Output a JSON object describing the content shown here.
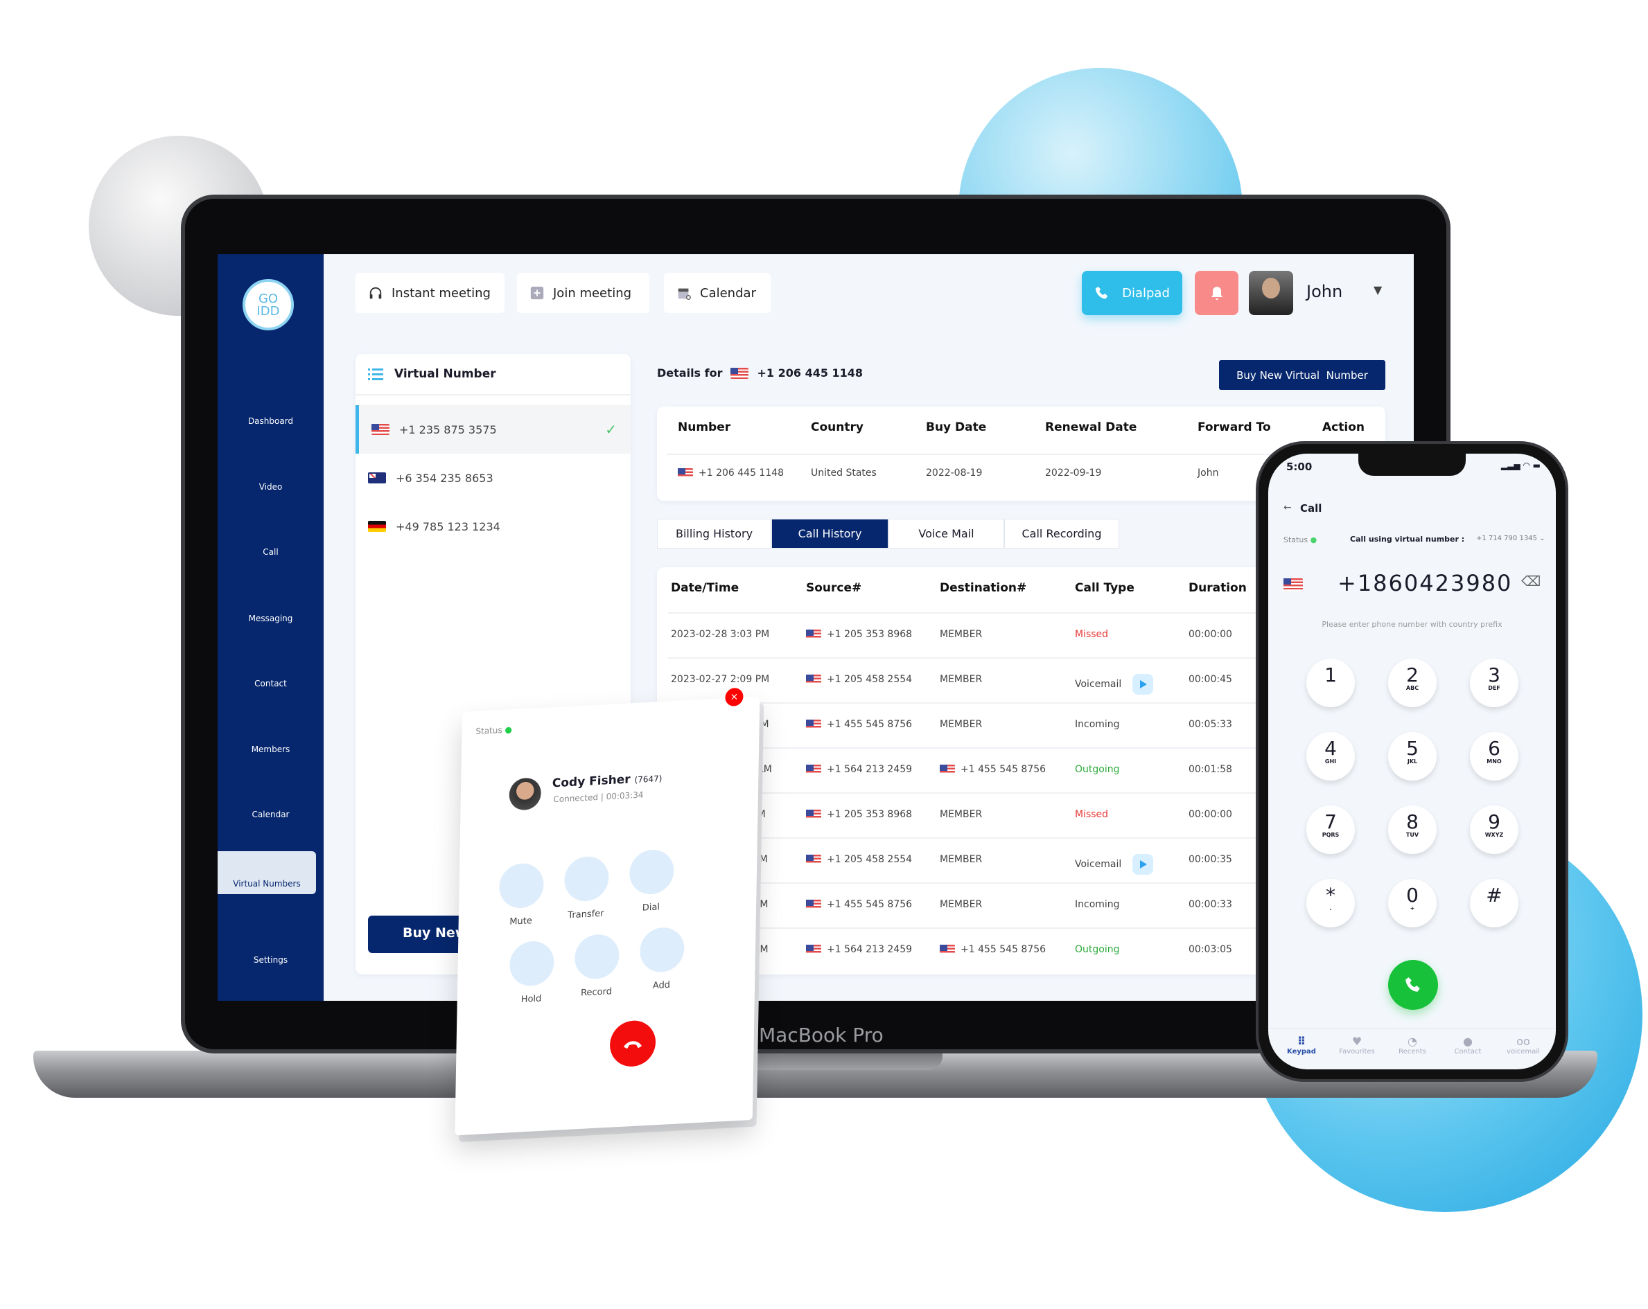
{
  "device_label": "MacBook Pro",
  "colors": {
    "sidebar": "#06276e",
    "accent": "#06276e",
    "dialpad": "#2fbdea",
    "bell": "#f88a8a",
    "missed": "#e53935",
    "outgoing": "#2eaa3c",
    "call_green": "#17c23a",
    "hangup": "#f40d0d"
  },
  "logo": {
    "line1": "GO",
    "line2": "IDD"
  },
  "sidebar": {
    "items": [
      {
        "label": "Dashboard",
        "icon": "dashboard-icon"
      },
      {
        "label": "Video",
        "icon": "video-icon"
      },
      {
        "label": "Call",
        "icon": "phone-icon"
      },
      {
        "label": "Messaging",
        "icon": "chat-icon"
      },
      {
        "label": "Contact",
        "icon": "user-icon"
      },
      {
        "label": "Members",
        "icon": "members-icon"
      },
      {
        "label": "Calendar",
        "icon": "calendar-icon"
      },
      {
        "label": "Virtual Numbers",
        "icon": "list-icon",
        "active": true
      },
      {
        "label": "Settings",
        "icon": "gear-icon"
      }
    ]
  },
  "topbar": {
    "instant_meeting": "Instant meeting",
    "join_meeting": "Join meeting",
    "calendar": "Calendar",
    "dialpad": "Dialpad",
    "user_name": "John"
  },
  "virtual_numbers": {
    "title": "Virtual Number",
    "items": [
      {
        "number": "+1 235 875 3575",
        "flag": "us",
        "selected": true
      },
      {
        "number": "+6 354 235 8653",
        "flag": "au"
      },
      {
        "number": "+49 785 123 1234",
        "flag": "de"
      }
    ],
    "buy_button": "Buy New virt"
  },
  "details": {
    "label": "Details for",
    "number": "+1 206 445 1148",
    "buy_button": "Buy New Virtual  Number",
    "columns": [
      "Number",
      "Country",
      "Buy Date",
      "Renewal Date",
      "Forward To",
      "Action"
    ],
    "row": [
      "+1 206 445 1148",
      "United States",
      "2022-08-19",
      "2022-09-19",
      "John"
    ]
  },
  "tabs": [
    "Billing History",
    "Call History",
    "Voice Mail",
    "Call Recording"
  ],
  "active_tab": "Call History",
  "call_history": {
    "columns": [
      "Date/Time",
      "Source#",
      "Destination#",
      "Call Type",
      "Duration"
    ],
    "rows": [
      {
        "date": "2023-02-28 3:03 PM",
        "source": "+1 205 353 8968",
        "dest": "MEMBER",
        "type": "Missed",
        "duration": "00:00:00"
      },
      {
        "date": "2023-02-27 2:09 PM",
        "source": "+1 205 458 2554",
        "dest": "MEMBER",
        "type": "Voicemail",
        "duration": "00:00:45",
        "play": true
      },
      {
        "date": "02-27 4:45 PM",
        "source": "+1 455 545 8756",
        "dest": "MEMBER",
        "type": "Incoming",
        "duration": "00:05:33"
      },
      {
        "date": "-25 12:03 AM",
        "source": "+1 564 213 2459",
        "dest": "+1 455 545 8756",
        "dest_flag": true,
        "type": "Outgoing",
        "duration": "00:01:58"
      },
      {
        "date": "28 3:03 PM",
        "source": "+1 205 353 8968",
        "dest": "MEMBER",
        "type": "Missed",
        "duration": "00:00:00"
      },
      {
        "date": "7 2:09 PM",
        "source": "+1 205 458 2554",
        "dest": "MEMBER",
        "type": "Voicemail",
        "duration": "00:00:35",
        "play": true
      },
      {
        "date": "4:45 PM",
        "source": "+1 455 545 8756",
        "dest": "MEMBER",
        "type": "Incoming",
        "duration": "00:00:33"
      },
      {
        "date": ":03 AM",
        "source": "+1 564 213 2459",
        "dest": "+1 455 545 8756",
        "dest_flag": true,
        "type": "Outgoing",
        "duration": "00:03:05"
      }
    ]
  },
  "call_popup": {
    "status": "Status",
    "name": "Cody Fisher",
    "ext": "(7647)",
    "connection": "Connected | 00:03:34",
    "buttons": [
      "Mute",
      "Transfer",
      "Dial",
      "Hold",
      "Record",
      "Add"
    ]
  },
  "phone": {
    "time": "5:00",
    "title": "Call",
    "status": "Status",
    "via_label": "Call using virtual number :",
    "via_number": "+1 714 790 1345",
    "dialed": "+1860423980",
    "hint": "Please enter phone number with country prefix",
    "keys": [
      [
        "1",
        ""
      ],
      [
        "2",
        "ABC"
      ],
      [
        "3",
        "DEF"
      ],
      [
        "4",
        "GHI"
      ],
      [
        "5",
        "JKL"
      ],
      [
        "6",
        "MNO"
      ],
      [
        "7",
        "PQRS"
      ],
      [
        "8",
        "TUV"
      ],
      [
        "9",
        "WXYZ"
      ],
      [
        "*",
        "."
      ],
      [
        "0",
        "+"
      ],
      [
        "#",
        ""
      ]
    ],
    "tabs": [
      "Keypad",
      "Favourites",
      "Recents",
      "Contact",
      "voicemail"
    ],
    "active_tab": "Keypad"
  }
}
